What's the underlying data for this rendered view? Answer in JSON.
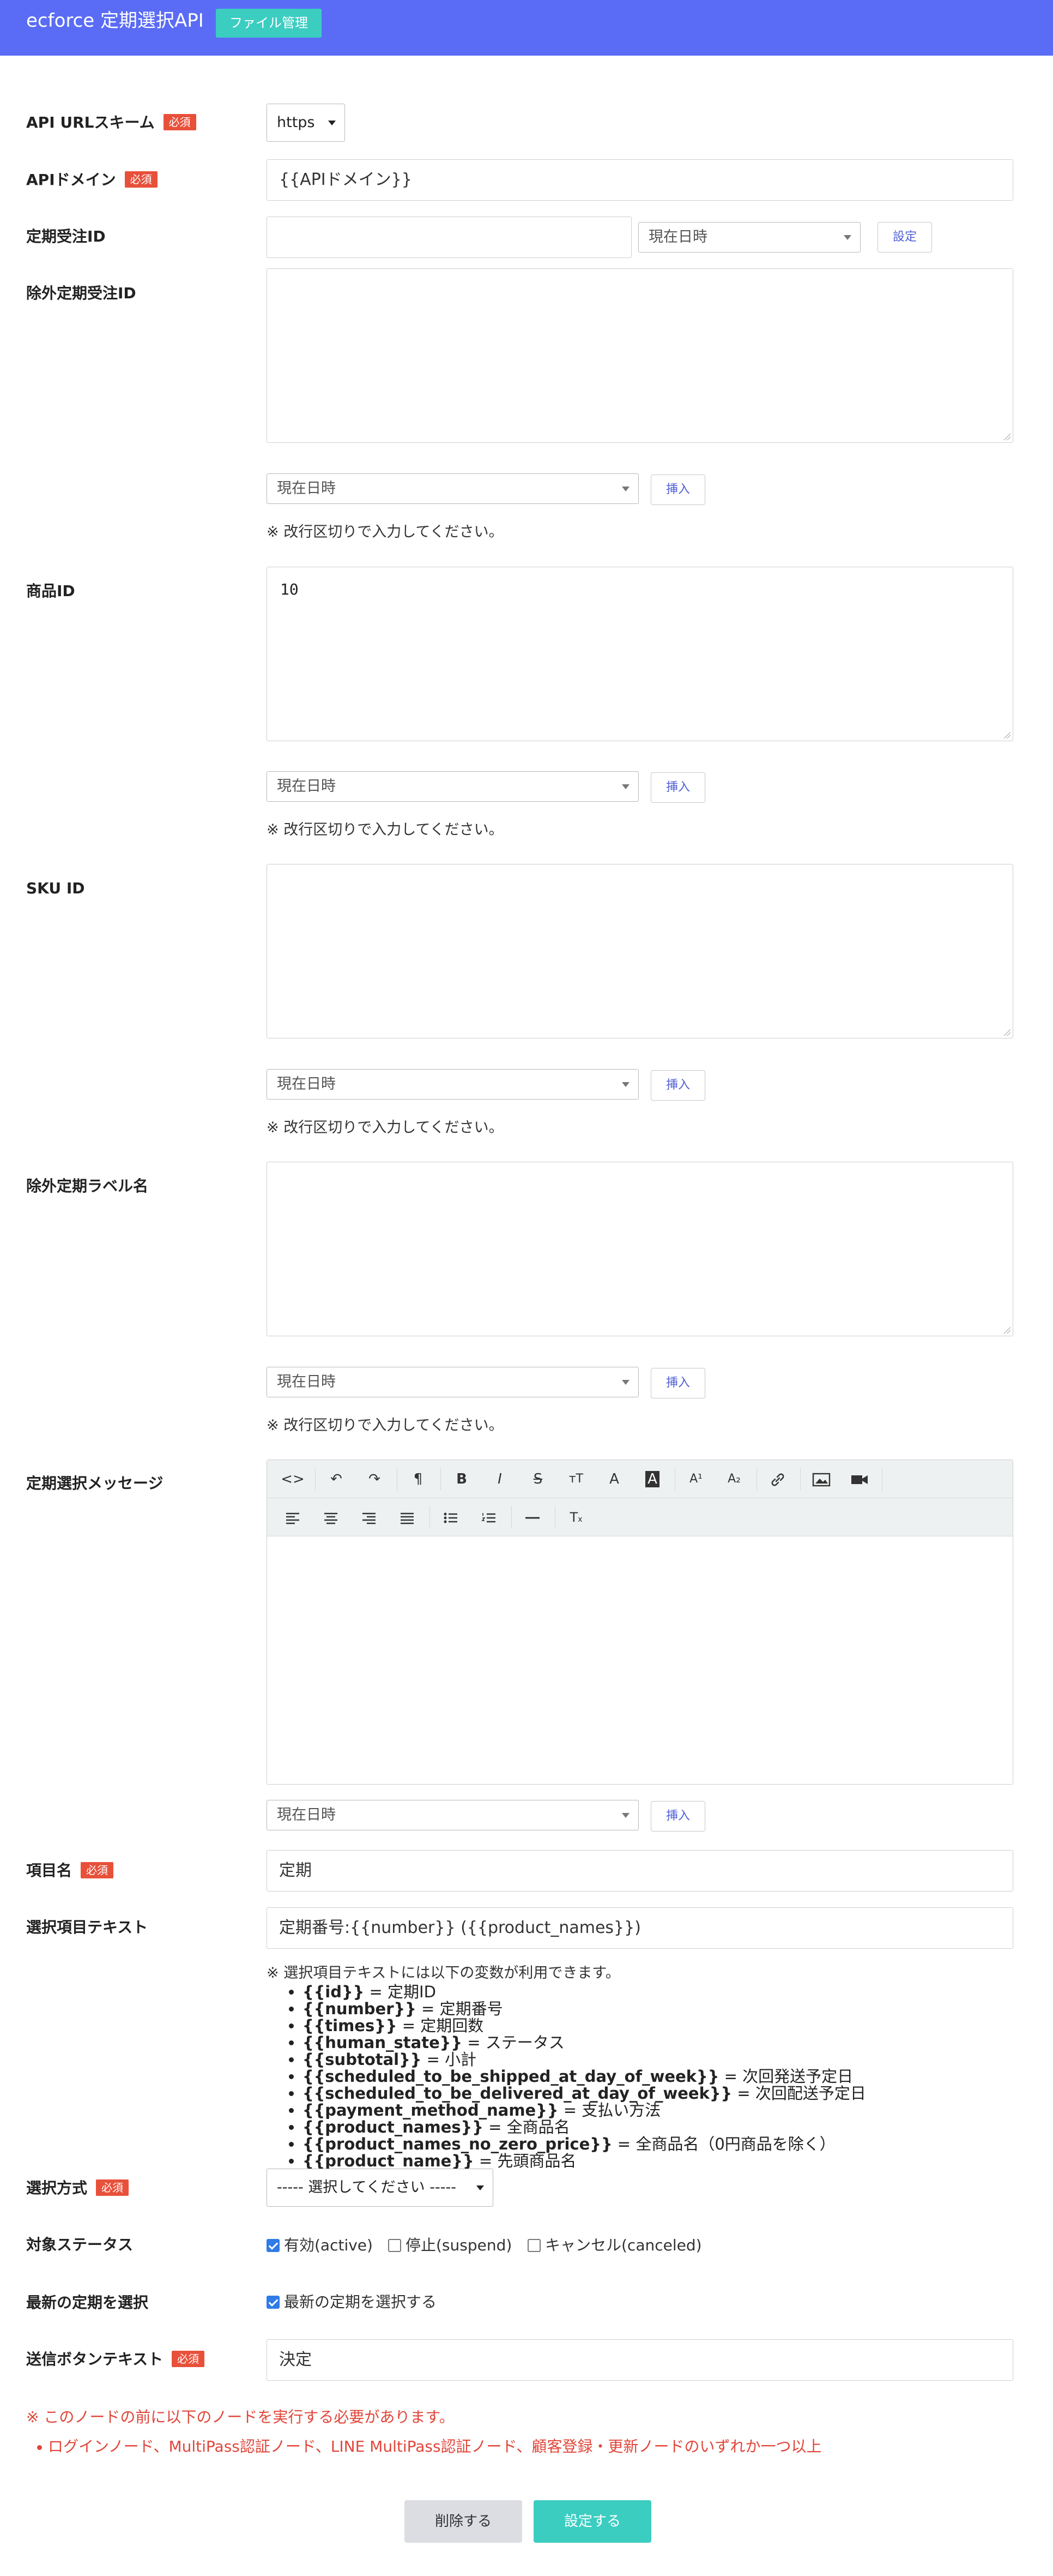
{
  "header": {
    "app_title": "ecforce 定期選択API",
    "file_button": "ファイル管理",
    "bar_color": "#5a6cf5",
    "button_color": "#3ccdc1"
  },
  "required_badge": "必須",
  "fields": {
    "url_scheme": {
      "label": "API URLスキーム",
      "value": "https"
    },
    "api_domain": {
      "label": "APIドメイン",
      "value": "{{APIドメイン}}"
    },
    "subscription_id": {
      "label": "定期受注ID",
      "value": "",
      "select": "現在日時",
      "button": "設定"
    },
    "excluded_subscription_id": {
      "label": "除外定期受注ID",
      "value": "",
      "select": "現在日時",
      "button": "挿入",
      "note": "※ 改行区切りで入力してください。"
    },
    "product_id": {
      "label": "商品ID",
      "value": "10",
      "select": "現在日時",
      "button": "挿入",
      "note": "※ 改行区切りで入力してください。"
    },
    "sku_id": {
      "label": "SKU ID",
      "value": "",
      "select": "現在日時",
      "button": "挿入",
      "note": "※ 改行区切りで入力してください。"
    },
    "excluded_label": {
      "label": "除外定期ラベル名",
      "value": "",
      "select": "現在日時",
      "button": "挿入",
      "note": "※ 改行区切りで入力してください。"
    },
    "message": {
      "label": "定期選択メッセージ",
      "select": "現在日時",
      "button": "挿入"
    },
    "item_name": {
      "label": "項目名",
      "value": "定期"
    },
    "option_text": {
      "label": "選択項目テキスト",
      "value": "定期番号:{{number}} ({{product_names}})",
      "note": "※ 選択項目テキストには以下の変数が利用できます。",
      "variables": [
        {
          "var": "{{id}}",
          "desc": " = 定期ID"
        },
        {
          "var": "{{number}}",
          "desc": " = 定期番号"
        },
        {
          "var": "{{times}}",
          "desc": " = 定期回数"
        },
        {
          "var": "{{human_state}}",
          "desc": " = ステータス"
        },
        {
          "var": "{{subtotal}}",
          "desc": " = 小計"
        },
        {
          "var": "{{scheduled_to_be_shipped_at_day_of_week}}",
          "desc": " = 次回発送予定日"
        },
        {
          "var": "{{scheduled_to_be_delivered_at_day_of_week}}",
          "desc": " = 次回配送予定日"
        },
        {
          "var": "{{payment_method_name}}",
          "desc": " = 支払い方法"
        },
        {
          "var": "{{product_names}}",
          "desc": " = 全商品名"
        },
        {
          "var": "{{product_names_no_zero_price}}",
          "desc": " = 全商品名（0円商品を除く）"
        },
        {
          "var": "{{product_name}}",
          "desc": " = 先頭商品名"
        }
      ]
    },
    "select_method": {
      "label": "選択方式",
      "value": "----- 選択してください -----"
    },
    "target_status": {
      "label": "対象ステータス",
      "options": [
        {
          "text": "有効(active)",
          "checked": true
        },
        {
          "text": "停止(suspend)",
          "checked": false
        },
        {
          "text": "キャンセル(canceled)",
          "checked": false
        }
      ]
    },
    "latest": {
      "label": "最新の定期を選択",
      "option": "最新の定期を選択する",
      "checked": true
    },
    "submit_text": {
      "label": "送信ボタンテキスト",
      "value": "決定"
    }
  },
  "toolbar": {
    "row1": [
      "<>",
      "↶",
      "↷",
      "¶",
      "B",
      "I",
      "S",
      "тT",
      "A",
      "A",
      "A",
      "A",
      "🔗",
      "img",
      "video"
    ],
    "row2": [
      "align-left",
      "align-center",
      "align-right",
      "justify",
      "bullet-list",
      "number-list",
      "hr",
      "clear-format"
    ]
  },
  "error": {
    "message": "※ このノードの前に以下のノードを実行する必要があります。",
    "items": [
      "ログインノード、MultiPass認証ノード、LINE MultiPass認証ノード、顧客登録・更新ノードのいずれか一つ以上"
    ],
    "color": "#e0463a"
  },
  "footer": {
    "delete": "削除する",
    "save": "設定する"
  }
}
